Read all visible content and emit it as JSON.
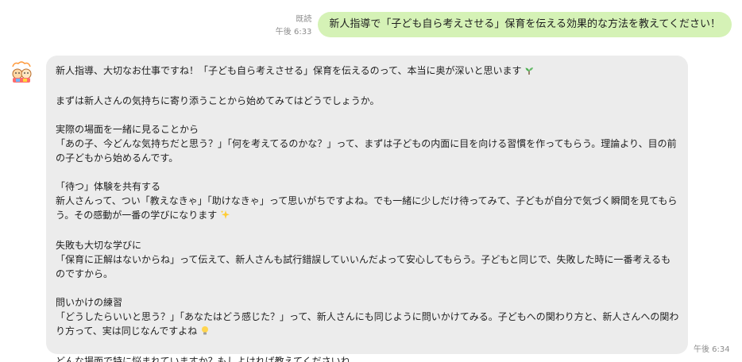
{
  "outgoing": {
    "read_label": "既読",
    "time": "午後 6:33",
    "text": "新人指導で「子ども自ら考えさせる」保育を伝える効果的な方法を教えてください！"
  },
  "incoming": {
    "time": "午後 6:34",
    "intro": "新人指導、大切なお仕事ですね！「子ども自ら考えさせる」保育を伝えるのって、本当に奥が深いと思います",
    "lead": "まずは新人さんの気持ちに寄り添うことから始めてみてはどうでしょうか。",
    "sections": [
      {
        "heading": "実際の場面を一緒に見ることから",
        "body": "「あの子、今どんな気持ちだと思う？」「何を考えてるのかな？」って、まずは子どもの内面に目を向ける習慣を作ってもらう。理論より、目の前の子どもから始めるんです。"
      },
      {
        "heading": "「待つ」体験を共有する",
        "body": "新人さんって、つい「教えなきゃ」「助けなきゃ」って思いがちですよね。でも一緒に少しだけ待ってみて、子どもが自分で気づく瞬間を見てもらう。その感動が一番の学びになります"
      },
      {
        "heading": "失敗も大切な学びに",
        "body": "「保育に正解はないからね」って伝えて、新人さんも試行錯誤していいんだよって安心してもらう。子どもと同じで、失敗した時に一番考えるものですから。"
      },
      {
        "heading": "問いかけの練習",
        "body": "「どうしたらいいと思う？」「あなたはどう感じた？」って、新人さんにも同じように問いかけてみる。子どもへの関わり方と、新人さんへの関わり方って、実は同じなんですよね"
      }
    ],
    "closing": "どんな場面で特に悩まれていますか？もしよければ教えてくださいね。"
  }
}
